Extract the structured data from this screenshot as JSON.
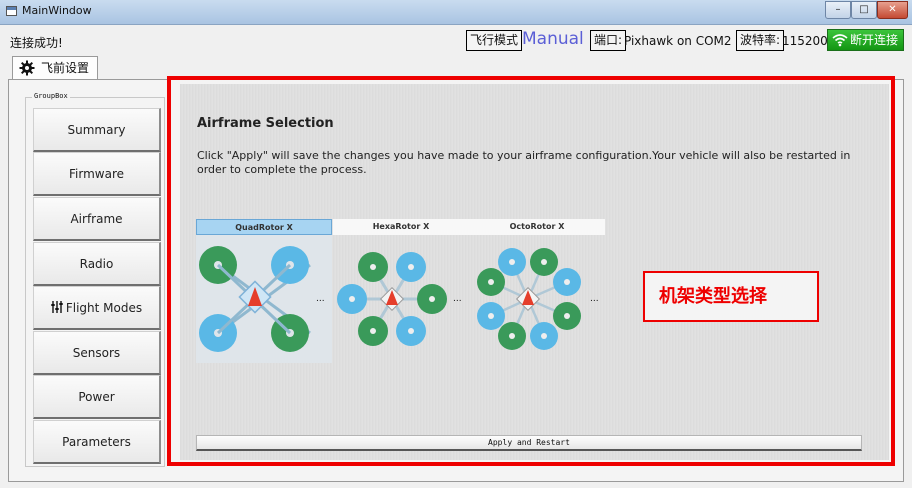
{
  "window": {
    "title": "MainWindow",
    "minimize": "–",
    "maximize": "□",
    "close": "✕"
  },
  "status": {
    "connection": "连接成功!",
    "flight_mode_label": "飞行模式",
    "flight_mode_value": "Manual",
    "port_label": "端口:",
    "port_value": "Pixhawk on COM2",
    "baud_label": "波特率:",
    "baud_value": "115200",
    "disconnect_label": "断开连接"
  },
  "tabs": [
    {
      "label": "飞前设置",
      "icon": "gear-icon"
    }
  ],
  "groupbox": {
    "label": "GroupBox"
  },
  "nav": {
    "items": [
      {
        "label": "Summary"
      },
      {
        "label": "Firmware"
      },
      {
        "label": "Airframe"
      },
      {
        "label": "Radio"
      },
      {
        "label": "Flight Modes",
        "icon": "sliders-icon"
      },
      {
        "label": "Sensors"
      },
      {
        "label": "Power"
      },
      {
        "label": "Parameters"
      }
    ]
  },
  "content": {
    "heading": "Airframe Selection",
    "description": "Click \"Apply\" will save the changes you have made to your airframe configuration.Your vehicle will also be restarted in order to complete the process.",
    "frames": [
      {
        "label": "QuadRotor X",
        "selected": true
      },
      {
        "label": "HexaRotor X",
        "selected": false
      },
      {
        "label": "OctoRotor X",
        "selected": false
      }
    ],
    "ellipsis": "...",
    "callout": "机架类型选择",
    "apply_label": "Apply and Restart"
  },
  "colors": {
    "accent_red": "#ee0000",
    "connect_green": "#139613",
    "mode_blue": "#5b5fd6",
    "rotor_green": "#3a9a5a",
    "rotor_blue": "#5ab8e6",
    "arrow_red": "#e53e2b"
  }
}
